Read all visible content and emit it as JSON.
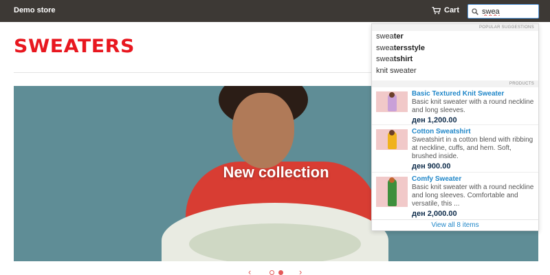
{
  "header": {
    "brand": "Demo store",
    "cart_label": "Cart",
    "search_value": "swea"
  },
  "page": {
    "title": "SWEATERS"
  },
  "hero": {
    "title": "New collection",
    "carousel_pages": 2,
    "active_page": 2
  },
  "suggestions": {
    "heading": "POPULAR SUGGESTIONS",
    "items": [
      {
        "match": "swea",
        "rest": "ter"
      },
      {
        "match": "swea",
        "rest": "tersstyle"
      },
      {
        "match": "swea",
        "rest": "tshirt"
      },
      {
        "match": "knit sweater",
        "rest": ""
      }
    ]
  },
  "products": {
    "heading": "PRODUCTS",
    "items": [
      {
        "name": "Basic Textured Knit Sweater",
        "description": "Basic knit sweater with a round neckline and long sleeves.",
        "price": "ден 1,200.00",
        "thumb_color": "#f1c9c9",
        "figure_color": "#c9a0d8"
      },
      {
        "name": "Cotton Sweatshirt",
        "description": "Sweatshirt in a cotton blend with ribbing at neckline, cuffs, and hem. Soft, brushed inside.",
        "price": "ден 900.00",
        "thumb_color": "#f1c9c9",
        "figure_color": "#f0b21e"
      },
      {
        "name": "Comfy Sweater",
        "description": "Basic knit sweater with a round neckline and long sleeves. Comfortable and versatile, this ...",
        "price": "ден 2,000.00",
        "thumb_color": "#f1c9c9",
        "figure_color": "#3e8f3c"
      }
    ],
    "view_all": "View all 8 items"
  },
  "colors": {
    "topbar": "#3d3935",
    "title_red": "#e8171f",
    "link_blue": "#1f86c8",
    "carousel_accent": "#e35959"
  }
}
